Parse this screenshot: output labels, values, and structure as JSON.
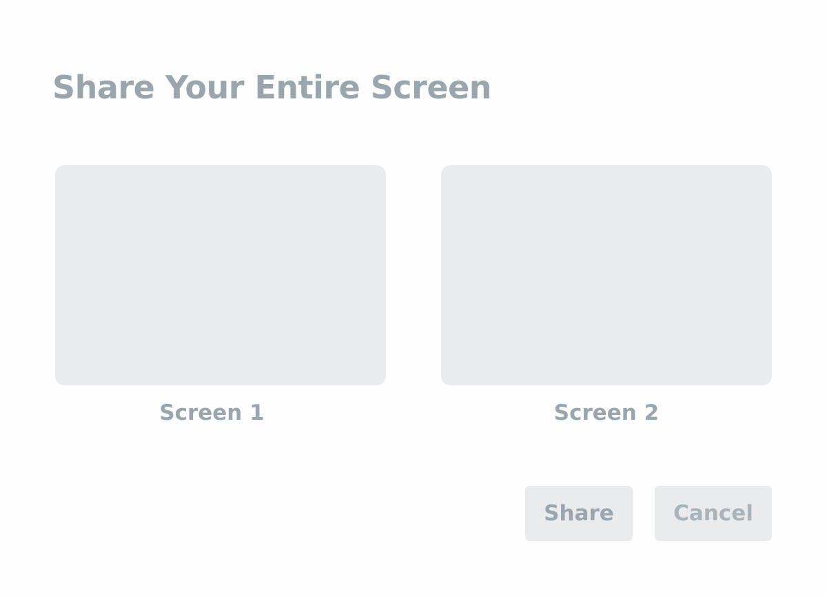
{
  "dialog": {
    "title": "Share Your Entire Screen"
  },
  "screens": [
    {
      "label": "Screen 1"
    },
    {
      "label": "Screen 2"
    }
  ],
  "actions": {
    "share_label": "Share",
    "cancel_label": "Cancel"
  },
  "colors": {
    "text": "#9aa6ae",
    "thumbnail_bg": "#e9ebed",
    "button_bg": "#e9ebed",
    "page_bg": "#fefefe"
  }
}
